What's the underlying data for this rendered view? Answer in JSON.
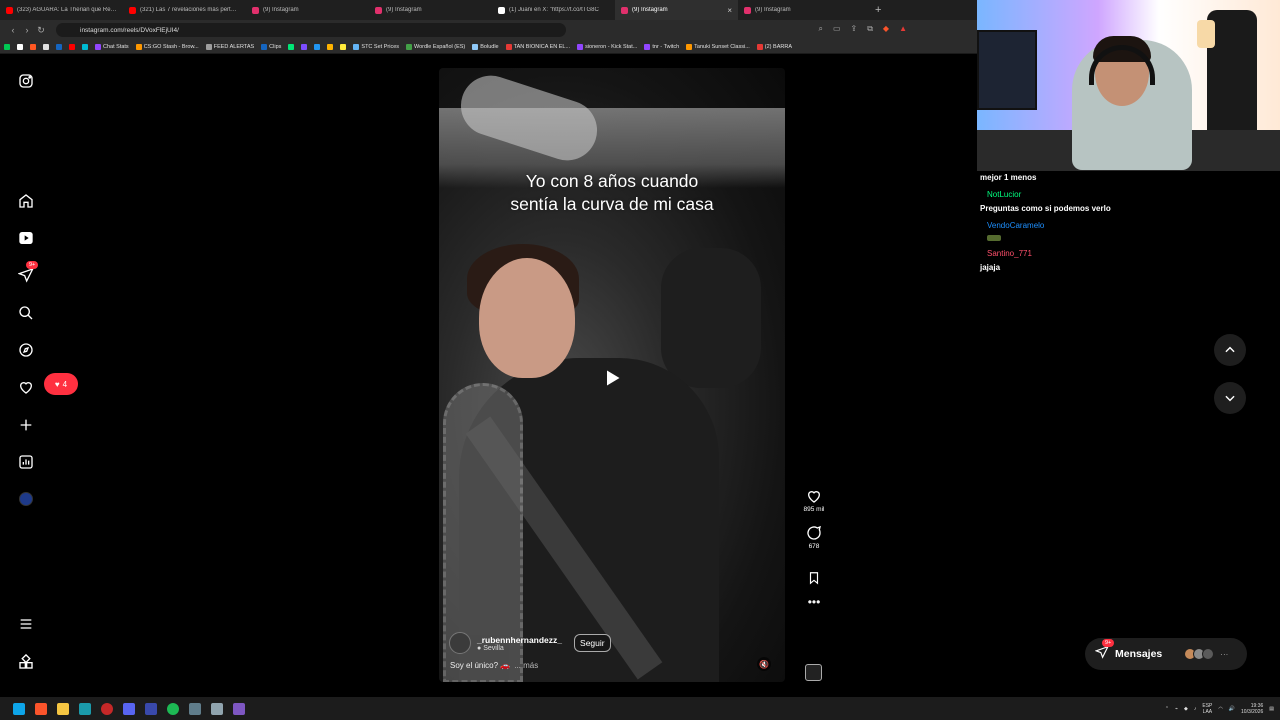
{
  "browser": {
    "tabs": [
      {
        "title": "(323) AGUARA: La Therian que Resulté",
        "favicon_color": "#ff0000",
        "active": false
      },
      {
        "title": "(321) Las 7 revelaciones más perturb...",
        "favicon_color": "#ff0000",
        "active": false
      },
      {
        "title": "(9) Instagram",
        "favicon_color": "#e1306c",
        "active": false
      },
      {
        "title": "(9) Instagram",
        "favicon_color": "#e1306c",
        "active": false
      },
      {
        "title": "(1) Juani en X: \"https://t.co/tTG8C",
        "favicon_color": "#ffffff",
        "active": false
      },
      {
        "title": "(9) Instagram",
        "favicon_color": "#e1306c",
        "active": true
      },
      {
        "title": "(9) Instagram",
        "favicon_color": "#e1306c",
        "active": false
      }
    ],
    "new_tab_label": "+",
    "close_tab_label": "×",
    "url": "instagram.com/reels/DVoxFlEjUI4/",
    "bookmarks": [
      {
        "label": "",
        "color": "#00c853"
      },
      {
        "label": "",
        "color": "#ffffff"
      },
      {
        "label": "",
        "color": "#ff5722"
      },
      {
        "label": "",
        "color": "#e0e0e0"
      },
      {
        "label": "",
        "color": "#1565c0"
      },
      {
        "label": "",
        "color": "#ff0000"
      },
      {
        "label": "",
        "color": "#00bcd4"
      },
      {
        "label": "Chat Stats",
        "color": "#9146ff"
      },
      {
        "label": "CS:GO Stash - Brow...",
        "color": "#ff9800"
      },
      {
        "label": "FEED ALERTAS",
        "color": "#9e9e9e"
      },
      {
        "label": "Clips",
        "color": "#1565c0"
      },
      {
        "label": "",
        "color": "#00e676"
      },
      {
        "label": "",
        "color": "#7c4dff"
      },
      {
        "label": "",
        "color": "#2196f3"
      },
      {
        "label": "",
        "color": "#ffb300"
      },
      {
        "label": "",
        "color": "#ffeb3b"
      },
      {
        "label": "STC Set Prices",
        "color": "#64b5f6"
      },
      {
        "label": "Wordle Español (ES)",
        "color": "#43a047"
      },
      {
        "label": "Boludle",
        "color": "#90caf9"
      },
      {
        "label": "TAN BIONICA EN EL...",
        "color": "#e53935"
      },
      {
        "label": "sioneron - Kick Stat...",
        "color": "#9146ff"
      },
      {
        "label": "tnr - Twitch",
        "color": "#9146ff"
      },
      {
        "label": "Tanuki Sunset Classi...",
        "color": "#ff9800"
      },
      {
        "label": "(2) BARRA",
        "color": "#e53935"
      }
    ]
  },
  "instagram": {
    "notification_badge": "9+",
    "likes_popup_count": "4",
    "reel": {
      "overlay_text_line1": "Yo con 8 años cuando",
      "overlay_text_line2": "sentía la curva de mi casa",
      "author": "_rubennhernandezz_",
      "location": "Sevilla",
      "follow_label": "Seguir",
      "description": "Soy el único? 🚗",
      "more_label": "... más",
      "likes": "895 mil",
      "comments": "678"
    },
    "messages_label": "Mensajes",
    "messages_badge": "9+"
  },
  "stream_chat": {
    "messages": [
      {
        "user": "",
        "text": "mejor 1 menos",
        "color": "#ffffff"
      },
      {
        "user": "NotLucior",
        "text": "Preguntas como si podemos verlo",
        "color": "#00ff7f"
      },
      {
        "user": "VendoCaramelo",
        "text": "",
        "color": "#1e90ff"
      },
      {
        "user": "Santino_771",
        "text": "jajaja",
        "color": "#ff4f6b"
      }
    ]
  },
  "taskbar": {
    "language": "ESP",
    "language_sub": "LAA",
    "time": "19:36",
    "date": "10/3/2026"
  }
}
